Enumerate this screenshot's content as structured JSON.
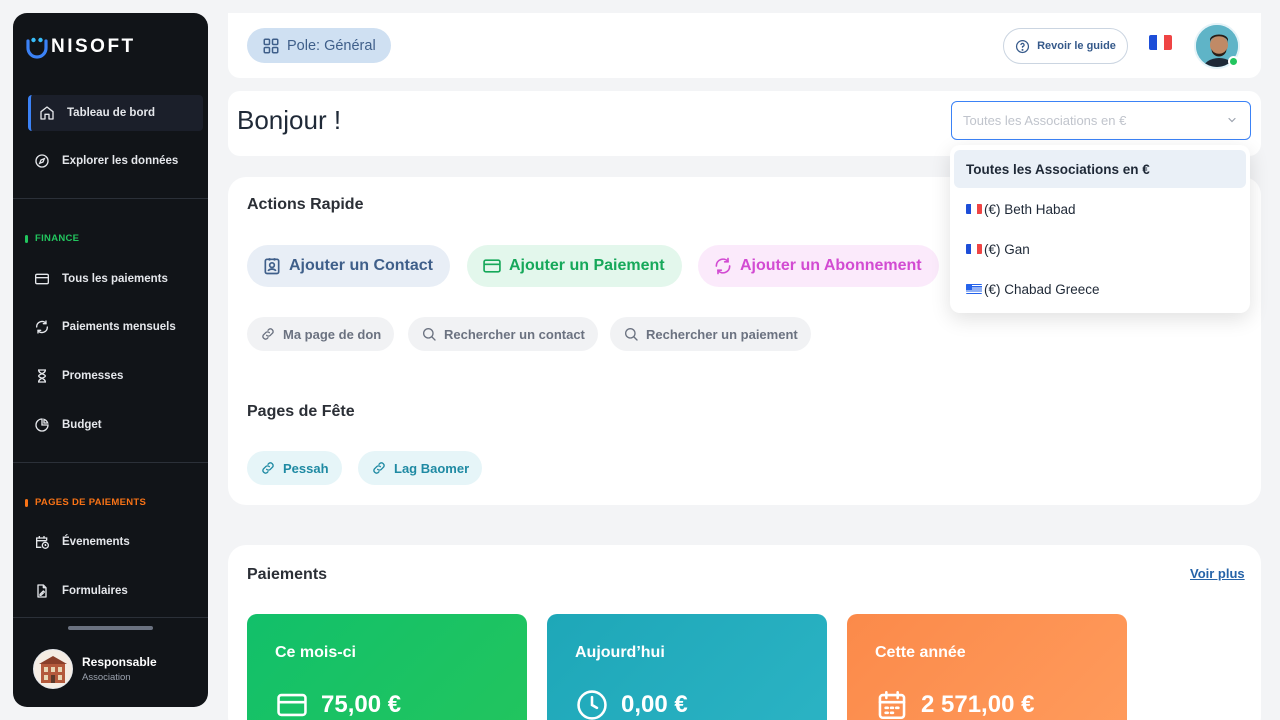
{
  "sidebar": {
    "brand": "NISOFT",
    "nav_top": [
      {
        "label": "Tableau de bord",
        "icon": "home-icon",
        "active": true
      },
      {
        "label": "Explorer les données",
        "icon": "compass-icon"
      }
    ],
    "finance_section": {
      "label": "FINANCE",
      "color": "#22c55e"
    },
    "finance_items": [
      {
        "label": "Tous les paiements",
        "icon": "credit-card-icon"
      },
      {
        "label": "Paiements mensuels",
        "icon": "refresh-icon"
      },
      {
        "label": "Promesses",
        "icon": "hourglass-icon"
      },
      {
        "label": "Budget",
        "icon": "pie-chart-icon"
      }
    ],
    "payment_pages_section": {
      "label": "PAGES DE PAIEMENTS",
      "color": "#f97316"
    },
    "payment_pages_items": [
      {
        "label": "Évenements",
        "icon": "calendar-clock-icon"
      },
      {
        "label": "Formulaires",
        "icon": "file-edit-icon"
      }
    ],
    "profile": {
      "name": "Responsable",
      "role": "Association"
    }
  },
  "topbar": {
    "pole_label": "Pole: Général",
    "guide_label": "Revoir le guide",
    "language": "fr"
  },
  "greeting": {
    "text": "Bonjour !",
    "select_placeholder": "Toutes les Associations en €"
  },
  "dropdown": {
    "options": [
      {
        "label": "Toutes les Associations en €",
        "selected": true,
        "flag": ""
      },
      {
        "label": "(€) Beth Habad",
        "flag": "fr"
      },
      {
        "label": "(€) Gan",
        "flag": "fr"
      },
      {
        "label": "(€) Chabad Greece",
        "flag": "gr"
      }
    ]
  },
  "actions": {
    "title": "Actions Rapide",
    "primary": [
      {
        "label": "Ajouter un Contact",
        "icon": "contact-card-icon"
      },
      {
        "label": "Ajouter un Paiement",
        "icon": "credit-card-icon"
      },
      {
        "label": "Ajouter un Abonnement",
        "icon": "refresh-icon"
      }
    ],
    "secondary": [
      {
        "label": "Ma page de don",
        "icon": "link-icon"
      },
      {
        "label": "Rechercher un contact",
        "icon": "search-icon"
      },
      {
        "label": "Rechercher un paiement",
        "icon": "search-icon"
      }
    ]
  },
  "fete": {
    "title": "Pages de Fête",
    "items": [
      {
        "label": "Pessah",
        "icon": "link-icon"
      },
      {
        "label": "Lag Baomer",
        "icon": "link-icon"
      }
    ]
  },
  "payments": {
    "title": "Paiements",
    "more_label": "Voir plus",
    "stats": [
      {
        "label": "Ce mois-ci",
        "value": "75,00 €",
        "icon": "credit-card-icon",
        "color_from": "#16c26a",
        "color_to": "#22c55e"
      },
      {
        "label": "Aujourd’hui",
        "value": "0,00 €",
        "icon": "clock-icon",
        "color_from": "#1ea7b8",
        "color_to": "#2bb3c4"
      },
      {
        "label": "Cette année",
        "value": "2 571,00 €",
        "icon": "calendar-icon",
        "color_from": "#fb8a4a",
        "color_to": "#ff9b5c"
      }
    ]
  },
  "colors": {
    "accent": "#3b82f6",
    "contact_pill_bg": "#e8eef6",
    "contact_pill_fg": "#3f5f8a",
    "payment_pill_bg": "#e3f7ec",
    "payment_pill_fg": "#16a85a",
    "subscription_pill_bg": "#fbeafb",
    "subscription_pill_fg": "#d24bd2"
  }
}
